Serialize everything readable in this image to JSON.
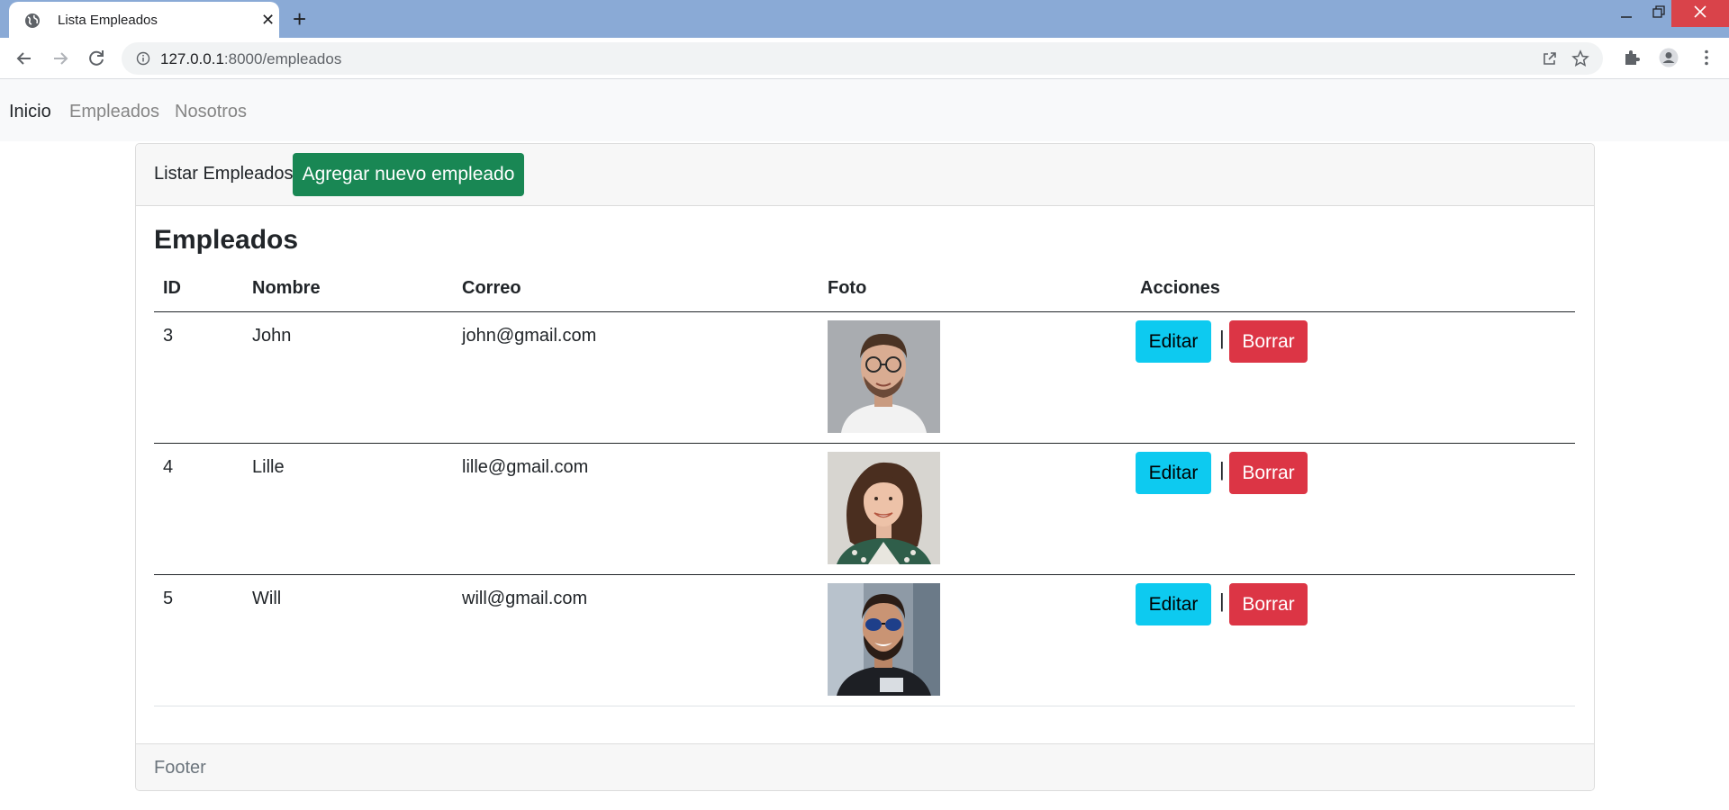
{
  "browser": {
    "tab_title": "Lista Empleados",
    "new_tab_label": "+",
    "url_host": "127.0.0.1",
    "url_path": ":8000/empleados"
  },
  "navbar": {
    "items": [
      {
        "label": "Inicio",
        "active": true
      },
      {
        "label": "Empleados",
        "active": false
      },
      {
        "label": "Nosotros",
        "active": false
      }
    ]
  },
  "card": {
    "header_text": "Listar Empleados",
    "add_button": "Agregar nuevo empleado",
    "title": "Empleados",
    "columns": [
      "ID",
      "Nombre",
      "Correo",
      "Foto",
      "Acciones"
    ],
    "rows": [
      {
        "id": "3",
        "nombre": "John",
        "correo": "john@gmail.com",
        "photo": "man-with-glasses-photo"
      },
      {
        "id": "4",
        "nombre": "Lille",
        "correo": "lille@gmail.com",
        "photo": "woman-curly-hair-photo"
      },
      {
        "id": "5",
        "nombre": "Will",
        "correo": "will@gmail.com",
        "photo": "man-with-sunglasses-photo"
      }
    ],
    "edit_label": "Editar",
    "separator": "|",
    "delete_label": "Borrar",
    "footer": "Footer"
  },
  "colors": {
    "success": "#198754",
    "info": "#0dcaf0",
    "danger": "#dc3545",
    "tabbar": "#8aaad6"
  }
}
